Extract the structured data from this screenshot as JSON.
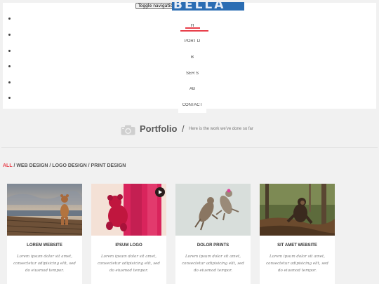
{
  "navbar": {
    "toggle_label": "Toggle navigation",
    "brand": "BELLA",
    "menu": [
      {
        "label": "HOME",
        "shown": "HOME",
        "active": true
      },
      {
        "label": "PORTFOLIO",
        "shown": "PORT      D"
      },
      {
        "label": "BLOG",
        "shown": "B"
      },
      {
        "label": "SERVICES",
        "shown": "SER        S"
      },
      {
        "label": "ABOUT",
        "shown": "AB"
      },
      {
        "label": "CONTACT",
        "shown": "CONTACT"
      }
    ]
  },
  "section": {
    "icon": "camera-icon",
    "title": "Portfolio",
    "slash": "/",
    "subtitle": "Here is the work we've done so far"
  },
  "filters": [
    {
      "label": "ALL",
      "active": true
    },
    {
      "label": "WEB DESIGN",
      "active": false
    },
    {
      "label": "LOGO DESIGN",
      "active": false
    },
    {
      "label": "PRINT DESIGN",
      "active": false
    }
  ],
  "cards": [
    {
      "title": "LOREM WEBSITE",
      "desc": "Lorem ipsum dolor sit amet, consectetur adipisicing elit, sed do eiusmod tempor."
    },
    {
      "title": "IPSUM LOGO",
      "desc": "Lorem ipsum dolor sit amet, consectetur adipisicing elit, sed do eiusmod tempor."
    },
    {
      "title": "DOLOR PRINTS",
      "desc": "Lorem ipsum dolor sit amet, consectetur adipisicing elit, sed do eiusmod tempor."
    },
    {
      "title": "SIT AMET WEBSITE",
      "desc": "Lorem ipsum dolor sit amet, consectetur adipisicing elit, sed do eiusmod tempor."
    }
  ],
  "colors": {
    "accent": "#e8404b",
    "brand_banner": "#2b6db3",
    "background": "#f1f1f1"
  }
}
